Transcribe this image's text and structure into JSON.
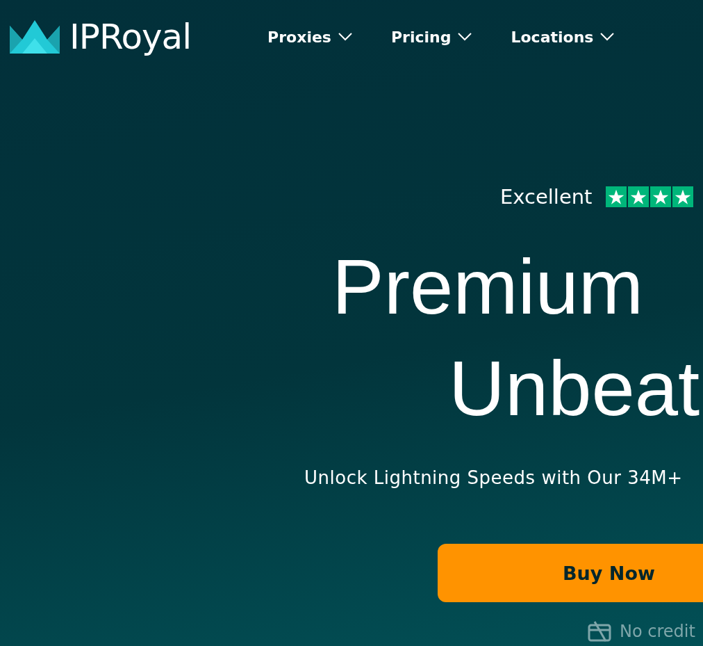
{
  "header": {
    "logo": "IPRoyal",
    "nav": [
      {
        "label": "Proxies"
      },
      {
        "label": "Pricing"
      },
      {
        "label": "Locations"
      }
    ]
  },
  "hero": {
    "rating": {
      "label": "Excellent",
      "stars": 4
    },
    "headline": [
      "Premium",
      "Unbeat"
    ],
    "subtitle": "Unlock Lightning Speeds with Our 34M+",
    "cta": "Buy Now",
    "note": "No credit"
  }
}
